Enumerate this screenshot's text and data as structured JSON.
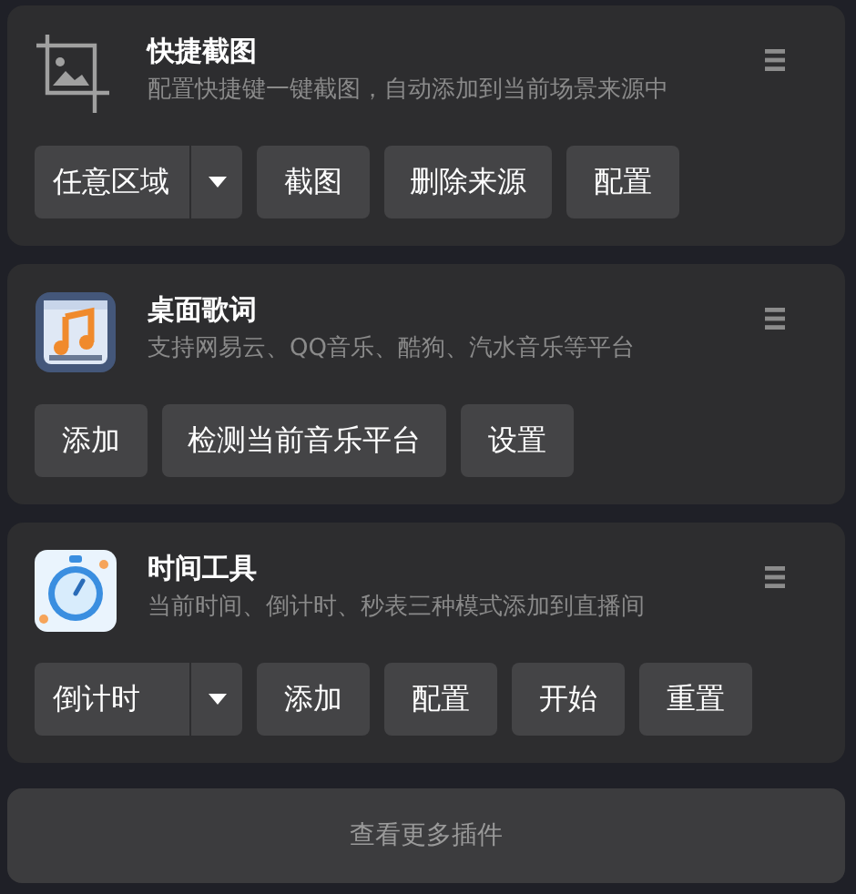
{
  "plugins": [
    {
      "kind": "screenshot",
      "title": "快捷截图",
      "description": "配置快捷键一键截图，自动添加到当前场景来源中",
      "controls": [
        {
          "kind": "dropdown",
          "value": "任意区域"
        },
        {
          "kind": "button",
          "label": "截图"
        },
        {
          "kind": "button",
          "label": "删除来源"
        },
        {
          "kind": "button",
          "label": "配置"
        }
      ]
    },
    {
      "kind": "lyrics",
      "title": "桌面歌词",
      "description": "支持网易云、QQ音乐、酷狗、汽水音乐等平台",
      "controls": [
        {
          "kind": "button",
          "label": "添加"
        },
        {
          "kind": "button",
          "label": "检测当前音乐平台"
        },
        {
          "kind": "button",
          "label": "设置"
        }
      ]
    },
    {
      "kind": "timer",
      "title": "时间工具",
      "description": "当前时间、倒计时、秒表三种模式添加到直播间",
      "controls": [
        {
          "kind": "dropdown",
          "value": "倒计时"
        },
        {
          "kind": "button",
          "label": "添加"
        },
        {
          "kind": "button",
          "label": "配置"
        },
        {
          "kind": "button",
          "label": "开始"
        },
        {
          "kind": "button",
          "label": "重置"
        }
      ]
    }
  ],
  "more_button": "查看更多插件"
}
